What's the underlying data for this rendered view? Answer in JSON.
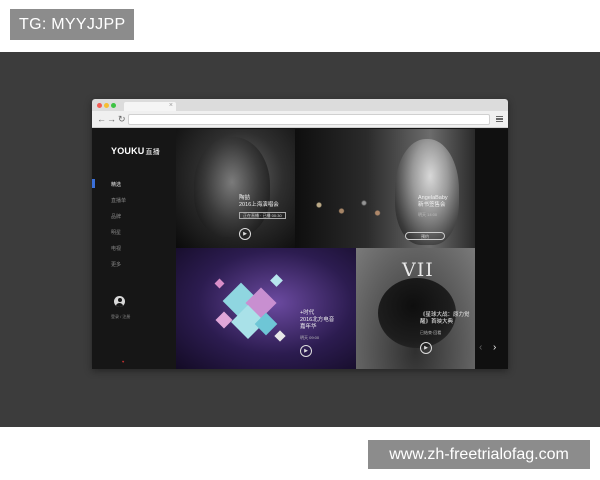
{
  "overlay": {
    "tg_label": "TG: MYYJJPP",
    "site_url": "www.zh-freetrialofag.com"
  },
  "browser": {
    "tab_close": "×",
    "back_icon": "←",
    "forward_icon": "→",
    "reload_icon": "↻"
  },
  "sidebar": {
    "logo_text": "YOUKU",
    "logo_sub": "直播",
    "items": [
      "精选",
      "直播单",
      "品牌",
      "明星",
      "电视",
      "更多"
    ],
    "login_text": "登录 / 注册"
  },
  "tiles": {
    "t1": {
      "title_line1": "陶喆",
      "title_line2": "2016上海演唱会",
      "live_label": "正在直播",
      "live_detail": "已播 00:30"
    },
    "t2": {
      "title_line1": "AngelaBaby",
      "title_line2": "新书签售会",
      "date": "明天 14:00",
      "button_label": "预约"
    },
    "t3": {
      "title_line1": "+时代",
      "title_line2": "2016北方电音",
      "title_line3": "嘉年华",
      "date": "明天 09:00"
    },
    "t4": {
      "roman": "VII",
      "title_line1": "《星球大战：原力觉",
      "title_line2": "醒》首映大典",
      "status": "已结束·回看"
    }
  },
  "controls": {
    "play_icon": "▶",
    "prev_arrow": "‹",
    "next_arrow": "›"
  }
}
